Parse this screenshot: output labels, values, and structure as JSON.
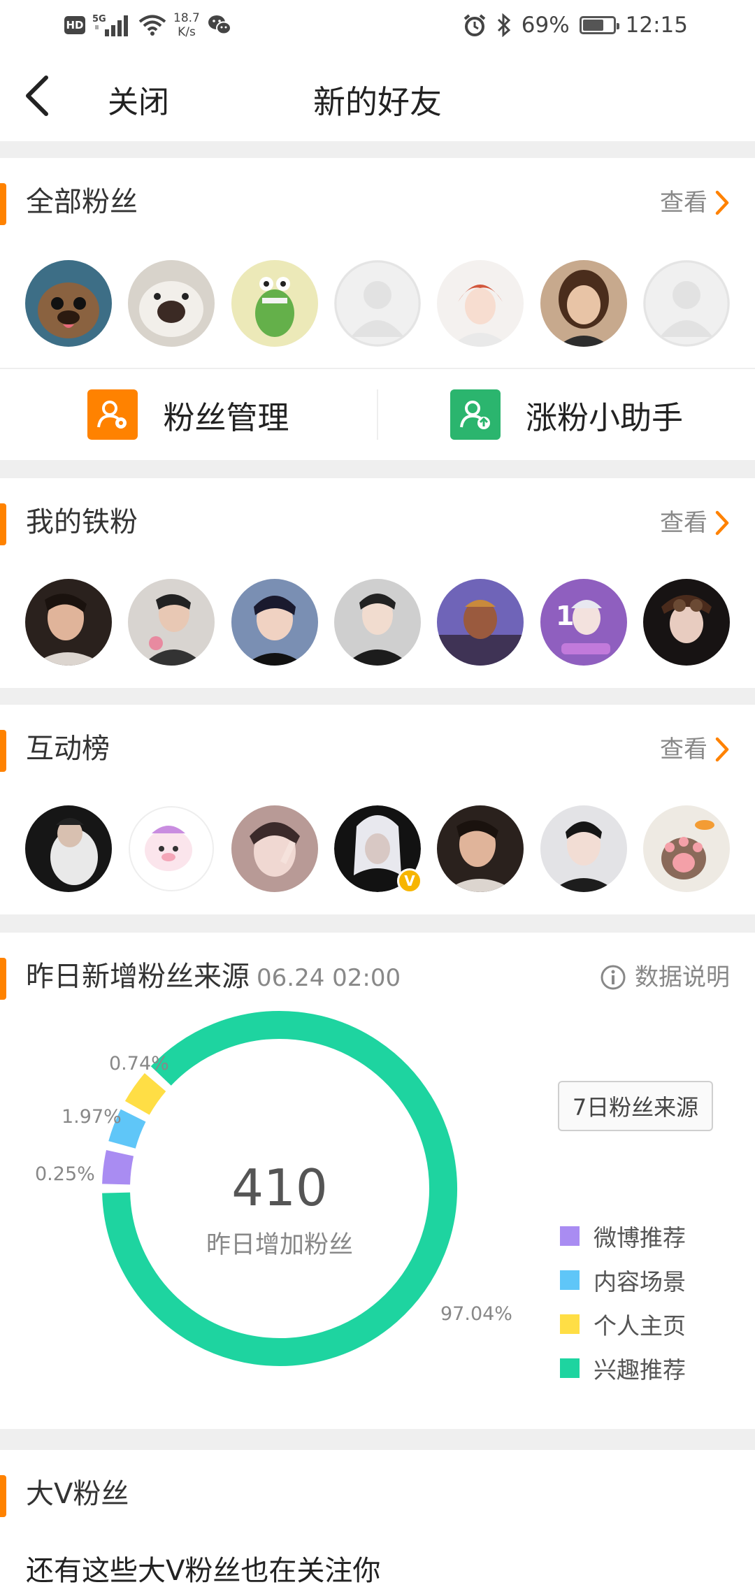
{
  "status_bar": {
    "hd": "HD",
    "net": "5G",
    "speed_value": "18.7",
    "speed_unit": "K/s",
    "battery": "69%",
    "battery_level": 0.69,
    "time": "12:15"
  },
  "nav": {
    "close_label": "关闭",
    "title": "新的好友"
  },
  "all_fans": {
    "title": "全部粉丝",
    "view_label": "查看",
    "manage_label": "粉丝管理",
    "grow_label": "涨粉小助手"
  },
  "iron_fans": {
    "title": "我的铁粉",
    "view_label": "查看"
  },
  "interaction": {
    "title": "互动榜",
    "view_label": "查看"
  },
  "sources": {
    "title": "昨日新增粉丝来源",
    "timestamp": "06.24 02:00",
    "explain_label": "数据说明",
    "seven_day_label": "7日粉丝来源",
    "center_value": "410",
    "center_label": "昨日增加粉丝",
    "legend": [
      {
        "label": "微博推荐",
        "color": "#a98cf2",
        "percent": "0.25%",
        "value": 0.25
      },
      {
        "label": "内容场景",
        "color": "#5fc6f8",
        "percent": "1.97%",
        "value": 1.97
      },
      {
        "label": "个人主页",
        "color": "#ffde45",
        "percent": "0.74%",
        "value": 0.74
      },
      {
        "label": "兴趣推荐",
        "color": "#1ed4a0",
        "percent": "97.04%",
        "value": 97.04
      }
    ]
  },
  "bigv": {
    "title": "大V粉丝",
    "description": "还有这些大V粉丝也在关注你"
  },
  "colors": {
    "accent": "#ff8200",
    "manage_icon": "#ff8200",
    "grow_icon": "#2bb56e"
  }
}
